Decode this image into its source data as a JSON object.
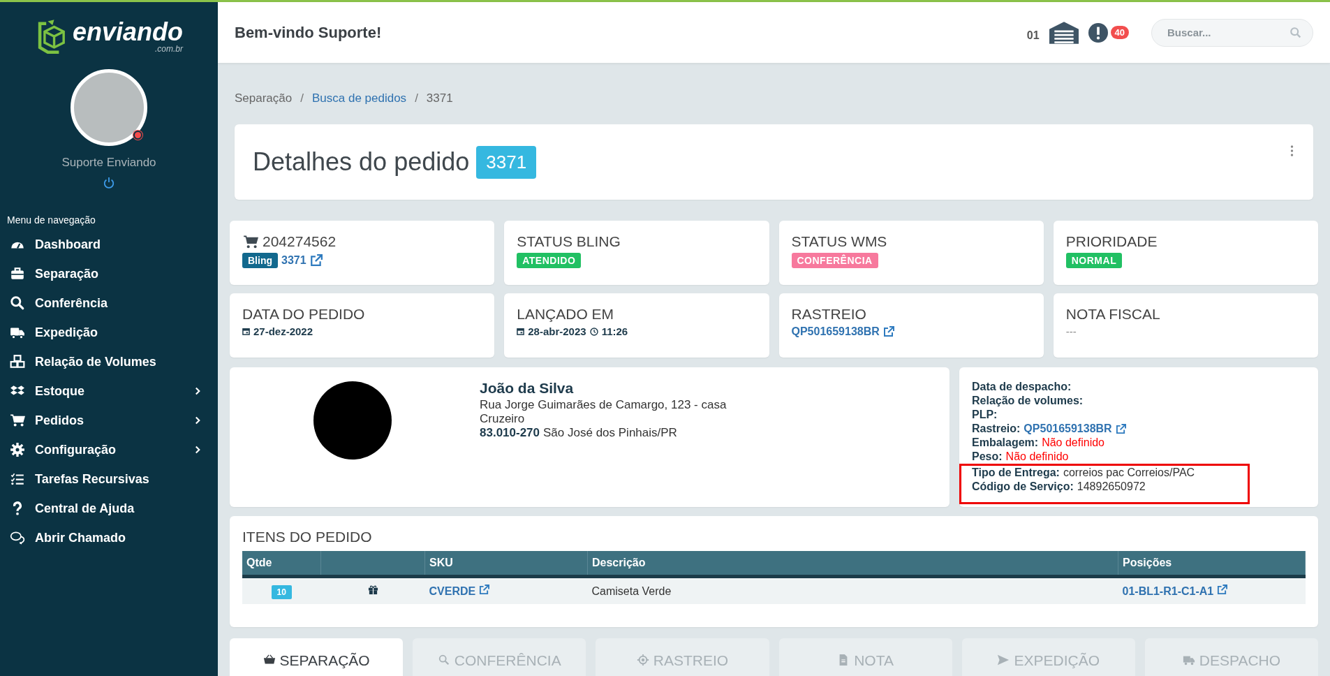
{
  "sidebar": {
    "logo": {
      "name": "enviando",
      "domain": ".com.br"
    },
    "user": {
      "name": "Suporte Enviando",
      "online": true
    },
    "menu_title": "Menu de navegação",
    "items": [
      {
        "label": "Dashboard",
        "expandable": false
      },
      {
        "label": "Separação",
        "expandable": false
      },
      {
        "label": "Conferência",
        "expandable": false
      },
      {
        "label": "Expedição",
        "expandable": false
      },
      {
        "label": "Relação de Volumes",
        "expandable": false
      },
      {
        "label": "Estoque",
        "expandable": true
      },
      {
        "label": "Pedidos",
        "expandable": true
      },
      {
        "label": "Configuração",
        "expandable": true
      },
      {
        "label": "Tarefas Recursivas",
        "expandable": false
      },
      {
        "label": "Central de Ajuda",
        "expandable": false
      },
      {
        "label": "Abrir Chamado",
        "expandable": false
      }
    ]
  },
  "header": {
    "greeting": "Bem-vindo Suporte!",
    "warehouse_count": "01",
    "alerts": "40",
    "search": {
      "placeholder": "Buscar..."
    }
  },
  "breadcrumb_separator": "/",
  "breadcrumb": [
    {
      "label": "Separação",
      "kind": "plain"
    },
    {
      "label": "Busca de pedidos",
      "kind": "link"
    },
    {
      "label": "3371",
      "kind": "plain"
    }
  ],
  "page_title": {
    "text": "Detalhes do pedido",
    "badge": "3371"
  },
  "info_cards": [
    {
      "kind": "order",
      "number": "204274562",
      "tag": "Bling",
      "link": "3371"
    },
    {
      "kind": "status",
      "title": "STATUS BLING",
      "badge": "ATENDIDO",
      "color": "#21c063"
    },
    {
      "kind": "status",
      "title": "STATUS WMS",
      "badge": "CONFERÊNCIA",
      "color": "#f7799d"
    },
    {
      "kind": "status",
      "title": "PRIORIDADE",
      "badge": "NORMAL",
      "color": "#21c063"
    },
    {
      "kind": "date",
      "title": "DATA DO PEDIDO",
      "date": "27-dez-2022"
    },
    {
      "kind": "date",
      "title": "LANÇADO EM",
      "date": "28-abr-2023",
      "time": "11:26"
    },
    {
      "kind": "link",
      "title": "RASTREIO",
      "value": "QP501659138BR"
    },
    {
      "kind": "text",
      "title": "NOTA FISCAL",
      "value": "---"
    }
  ],
  "customer": {
    "name": "João da Silva",
    "address": "Rua Jorge Guimarães de Camargo, 123 - casa",
    "district": "Cruzeiro",
    "zip": "83.010-270",
    "city": "São José dos Pinhais/PR"
  },
  "shipping_details": [
    {
      "label": "Data de despacho:",
      "kind": "empty"
    },
    {
      "label": "Relação de volumes:",
      "kind": "empty"
    },
    {
      "label": "PLP:",
      "kind": "empty"
    },
    {
      "label": "Rastreio:",
      "kind": "link",
      "value": "QP501659138BR"
    },
    {
      "label": "Embalagem:",
      "kind": "missing",
      "value": "Não definido"
    },
    {
      "label": "Peso:",
      "kind": "missing",
      "value": "Não definido"
    }
  ],
  "highlighted_details": [
    {
      "label": "Tipo de Entrega:",
      "kind": "plain",
      "value": "correios pac Correios/PAC"
    },
    {
      "label": "Código de Serviço:",
      "kind": "plain",
      "value": "14892650972"
    }
  ],
  "items": {
    "title": "ITENS DO PEDIDO",
    "columns": [
      "Qtde",
      "SKU",
      "Descrição",
      "Posições"
    ],
    "rows": [
      {
        "qty": "10",
        "sku": "CVERDE",
        "description": "Camiseta Verde",
        "position": "01-BL1-R1-C1-A1"
      }
    ]
  },
  "tabs": [
    {
      "label": "SEPARAÇÃO",
      "selected": true
    },
    {
      "label": "CONFERÊNCIA",
      "selected": false
    },
    {
      "label": "RASTREIO",
      "selected": false
    },
    {
      "label": "NOTA",
      "selected": false
    },
    {
      "label": "EXPEDIÇÃO",
      "selected": false
    },
    {
      "label": "DESPACHO",
      "selected": false
    }
  ]
}
